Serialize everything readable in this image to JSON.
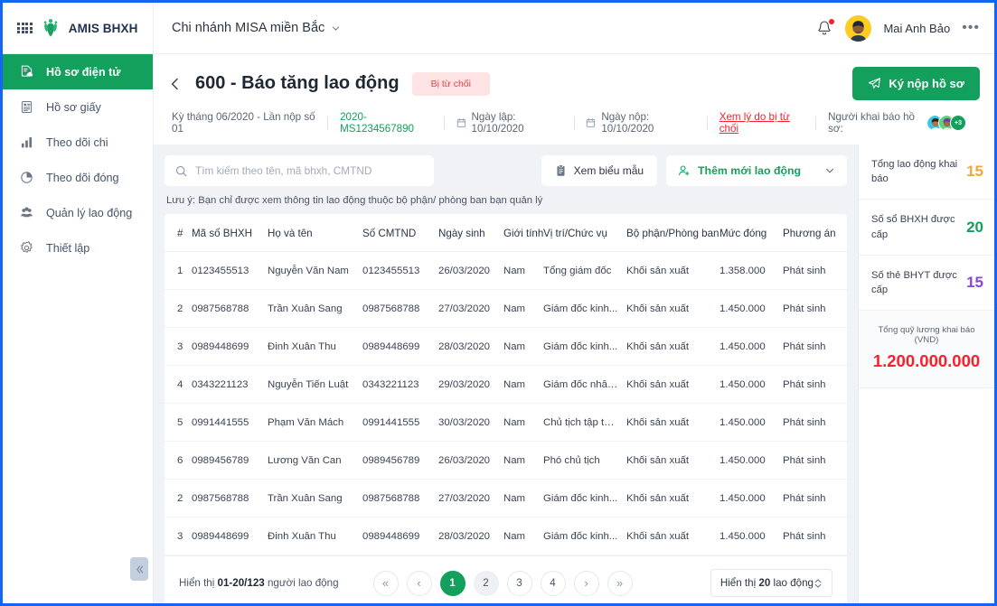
{
  "brand": {
    "name": "AMIS BHXH",
    "grid_icon": "app-grid-icon",
    "logo_icon": "misa-logo-icon"
  },
  "topbar": {
    "branch": "Chi nhánh MISA miền Bắc",
    "branch_chevron": "chevron-down-icon",
    "bell": "notification-bell-icon",
    "user_name": "Mai Anh Bảo",
    "more": "•••"
  },
  "sidebar": {
    "items": [
      {
        "label": "Hồ sơ điện tử",
        "icon": "electronic-document-icon",
        "active": true
      },
      {
        "label": "Hồ sơ giấy",
        "icon": "paper-document-icon",
        "active": false
      },
      {
        "label": "Theo dõi chi",
        "icon": "bar-chart-icon",
        "active": false
      },
      {
        "label": "Theo dõi đóng",
        "icon": "pie-chart-icon",
        "active": false
      },
      {
        "label": "Quản lý lao động",
        "icon": "people-group-icon",
        "active": false
      },
      {
        "label": "Thiết lập",
        "icon": "gear-icon",
        "active": false
      }
    ],
    "collapse": "«"
  },
  "page": {
    "back_icon": "back-arrow-icon",
    "title": "600 - Báo tăng lao động",
    "status_badge": "Bị từ chối",
    "sign_button": "Ký nộp hồ sơ",
    "sign_icon": "paper-plane-icon",
    "meta": {
      "period": "Kỳ tháng 06/2020 - Lần nộp số 01",
      "code": "2020-MS1234567890",
      "created_label": "Ngày lập: 10/10/2020",
      "submitted_label": "Ngày nộp: 10/10/2020",
      "reject_link": "Xem lý do bị từ chối",
      "declarers_label": "Người khai báo hồ sơ:",
      "avatar_more": "+3"
    }
  },
  "toolbar": {
    "search_placeholder": "Tìm kiếm theo tên, mã bhxh, CMTND",
    "search_value": "",
    "search_icon": "search-icon",
    "view_template": "Xem biểu mẫu",
    "view_template_icon": "clipboard-icon",
    "add_employee": "Thêm mới lao động",
    "add_employee_icon": "add-person-icon",
    "add_chevron": "chevron-down-icon",
    "note": "Lưu ý: Bạn chỉ được xem thông tin lao động thuộc bộ phận/ phòng ban bạn quản lý"
  },
  "table": {
    "columns": [
      "#",
      "Mã số BHXH",
      "Họ và tên",
      "Số CMTND",
      "Ngày sinh",
      "Giới tính",
      "Vị trí/Chức vụ",
      "Bộ phận/Phòng ban",
      "Mức đóng",
      "Phương án",
      ""
    ],
    "row_menu": "•••",
    "rows": [
      {
        "idx": "1",
        "ma": "0123455513",
        "ten": "Nguyễn Văn Nam",
        "cmnd": "0123455513",
        "ns": "26/03/2020",
        "gt": "Nam",
        "vt": "Tổng giám đốc",
        "bp": "Khối sản xuất",
        "md": "1.358.000",
        "pa": "Phát sinh"
      },
      {
        "idx": "2",
        "ma": "0987568788",
        "ten": "Trần Xuân Sang",
        "cmnd": "0987568788",
        "ns": "27/03/2020",
        "gt": "Nam",
        "vt": "Giám đốc kinh...",
        "bp": "Khối sản xuất",
        "md": "1.450.000",
        "pa": "Phát sinh"
      },
      {
        "idx": "3",
        "ma": "0989448699",
        "ten": "Đinh Xuân Thu",
        "cmnd": "0989448699",
        "ns": "28/03/2020",
        "gt": "Nam",
        "vt": "Giám đốc kinh...",
        "bp": "Khối sản xuất",
        "md": "1.450.000",
        "pa": "Phát sinh"
      },
      {
        "idx": "4",
        "ma": "0343221123",
        "ten": "Nguyễn Tiến Luật",
        "cmnd": "0343221123",
        "ns": "29/03/2020",
        "gt": "Nam",
        "vt": "Giám đốc nhân ...",
        "bp": "Khối sản xuất",
        "md": "1.450.000",
        "pa": "Phát sinh"
      },
      {
        "idx": "5",
        "ma": "0991441555",
        "ten": "Phạm Văn Mách",
        "cmnd": "0991441555",
        "ns": "30/03/2020",
        "gt": "Nam",
        "vt": "Chủ tịch tập toàn",
        "bp": "Khối sản xuất",
        "md": "1.450.000",
        "pa": "Phát sinh"
      },
      {
        "idx": "6",
        "ma": "0989456789",
        "ten": "Lương Văn Can",
        "cmnd": "0989456789",
        "ns": "26/03/2020",
        "gt": "Nam",
        "vt": "Phó chủ tịch",
        "bp": "Khối sản xuất",
        "md": "1.450.000",
        "pa": "Phát sinh"
      },
      {
        "idx": "2",
        "ma": "0987568788",
        "ten": "Trần Xuân Sang",
        "cmnd": "0987568788",
        "ns": "27/03/2020",
        "gt": "Nam",
        "vt": "Giám đốc kinh...",
        "bp": "Khối sản xuất",
        "md": "1.450.000",
        "pa": "Phát sinh"
      },
      {
        "idx": "3",
        "ma": "0989448699",
        "ten": "Đinh Xuân Thu",
        "cmnd": "0989448699",
        "ns": "28/03/2020",
        "gt": "Nam",
        "vt": "Giám đốc kinh...",
        "bp": "Khối sản xuất",
        "md": "1.450.000",
        "pa": "Phát sinh"
      }
    ]
  },
  "pagination": {
    "info_prefix": "Hiển thị ",
    "info_range": "01-20/123",
    "info_suffix": " người lao động",
    "first": "«",
    "prev": "‹",
    "next": "›",
    "last": "»",
    "pages": [
      "1",
      "2",
      "3",
      "4"
    ],
    "active_page": "1",
    "hover_page": "2",
    "page_size_prefix": "Hiển thị ",
    "page_size_value": "20",
    "page_size_suffix": " lao động",
    "page_size_icon": "updown-chevron-icon"
  },
  "stats": {
    "items": [
      {
        "label": "Tổng lao động khai báo",
        "value": "15",
        "color": "#f2a73b"
      },
      {
        "label": "Số sổ BHXH được cấp",
        "value": "20",
        "color": "#12a05c"
      },
      {
        "label": "Số thẻ BHYT được cấp",
        "value": "15",
        "color": "#8b45d6"
      }
    ],
    "salary_label": "Tổng quỹ lương khai báo (VND)",
    "salary_value": "1.200.000.000"
  }
}
